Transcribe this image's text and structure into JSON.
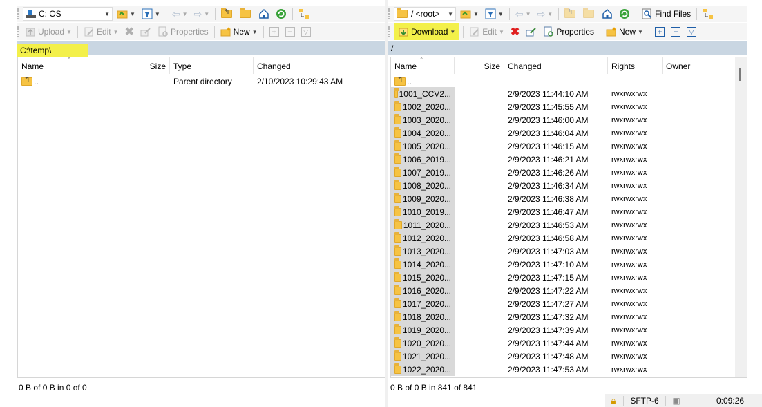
{
  "left": {
    "drive": "C: OS",
    "toolbar": {
      "upload": "Upload",
      "edit": "Edit",
      "properties": "Properties",
      "new": "New"
    },
    "path": "C:\\temp\\",
    "columns": {
      "name": "Name",
      "size": "Size",
      "type": "Type",
      "changed": "Changed"
    },
    "rows": [
      {
        "name": "..",
        "size": "",
        "type": "Parent directory",
        "changed": "2/10/2023  10:29:43 AM"
      }
    ],
    "status": "0 B of 0 B in 0 of 0"
  },
  "right": {
    "drive": "/ <root>",
    "toolbar": {
      "find_files": "Find Files",
      "download": "Download",
      "edit": "Edit",
      "properties": "Properties",
      "new": "New"
    },
    "path": "/",
    "columns": {
      "name": "Name",
      "size": "Size",
      "changed": "Changed",
      "rights": "Rights",
      "owner": "Owner"
    },
    "parent": "..",
    "rows": [
      {
        "name": "1001_CCV2...",
        "changed": "2/9/2023 11:44:10 AM",
        "rights": "rwxrwxrwx"
      },
      {
        "name": "1002_2020...",
        "changed": "2/9/2023 11:45:55 AM",
        "rights": "rwxrwxrwx"
      },
      {
        "name": "1003_2020...",
        "changed": "2/9/2023 11:46:00 AM",
        "rights": "rwxrwxrwx"
      },
      {
        "name": "1004_2020...",
        "changed": "2/9/2023 11:46:04 AM",
        "rights": "rwxrwxrwx"
      },
      {
        "name": "1005_2020...",
        "changed": "2/9/2023 11:46:15 AM",
        "rights": "rwxrwxrwx"
      },
      {
        "name": "1006_2019...",
        "changed": "2/9/2023 11:46:21 AM",
        "rights": "rwxrwxrwx"
      },
      {
        "name": "1007_2019...",
        "changed": "2/9/2023 11:46:26 AM",
        "rights": "rwxrwxrwx"
      },
      {
        "name": "1008_2020...",
        "changed": "2/9/2023 11:46:34 AM",
        "rights": "rwxrwxrwx"
      },
      {
        "name": "1009_2020...",
        "changed": "2/9/2023 11:46:38 AM",
        "rights": "rwxrwxrwx"
      },
      {
        "name": "1010_2019...",
        "changed": "2/9/2023 11:46:47 AM",
        "rights": "rwxrwxrwx"
      },
      {
        "name": "1011_2020...",
        "changed": "2/9/2023 11:46:53 AM",
        "rights": "rwxrwxrwx"
      },
      {
        "name": "1012_2020...",
        "changed": "2/9/2023 11:46:58 AM",
        "rights": "rwxrwxrwx"
      },
      {
        "name": "1013_2020...",
        "changed": "2/9/2023 11:47:03 AM",
        "rights": "rwxrwxrwx"
      },
      {
        "name": "1014_2020...",
        "changed": "2/9/2023 11:47:10 AM",
        "rights": "rwxrwxrwx"
      },
      {
        "name": "1015_2020...",
        "changed": "2/9/2023 11:47:15 AM",
        "rights": "rwxrwxrwx"
      },
      {
        "name": "1016_2020...",
        "changed": "2/9/2023 11:47:22 AM",
        "rights": "rwxrwxrwx"
      },
      {
        "name": "1017_2020...",
        "changed": "2/9/2023 11:47:27 AM",
        "rights": "rwxrwxrwx"
      },
      {
        "name": "1018_2020...",
        "changed": "2/9/2023 11:47:32 AM",
        "rights": "rwxrwxrwx"
      },
      {
        "name": "1019_2020...",
        "changed": "2/9/2023 11:47:39 AM",
        "rights": "rwxrwxrwx"
      },
      {
        "name": "1020_2020...",
        "changed": "2/9/2023 11:47:44 AM",
        "rights": "rwxrwxrwx"
      },
      {
        "name": "1021_2020...",
        "changed": "2/9/2023 11:47:48 AM",
        "rights": "rwxrwxrwx"
      },
      {
        "name": "1022_2020...",
        "changed": "2/9/2023 11:47:53 AM",
        "rights": "rwxrwxrwx"
      }
    ],
    "status": "0 B of 0 B in 841 of 841"
  },
  "statusbar": {
    "protocol": "SFTP-6",
    "elapsed": "0:09:26"
  },
  "highlight_color": "#f3f04a",
  "path_bar_color": "#c9d6e2"
}
